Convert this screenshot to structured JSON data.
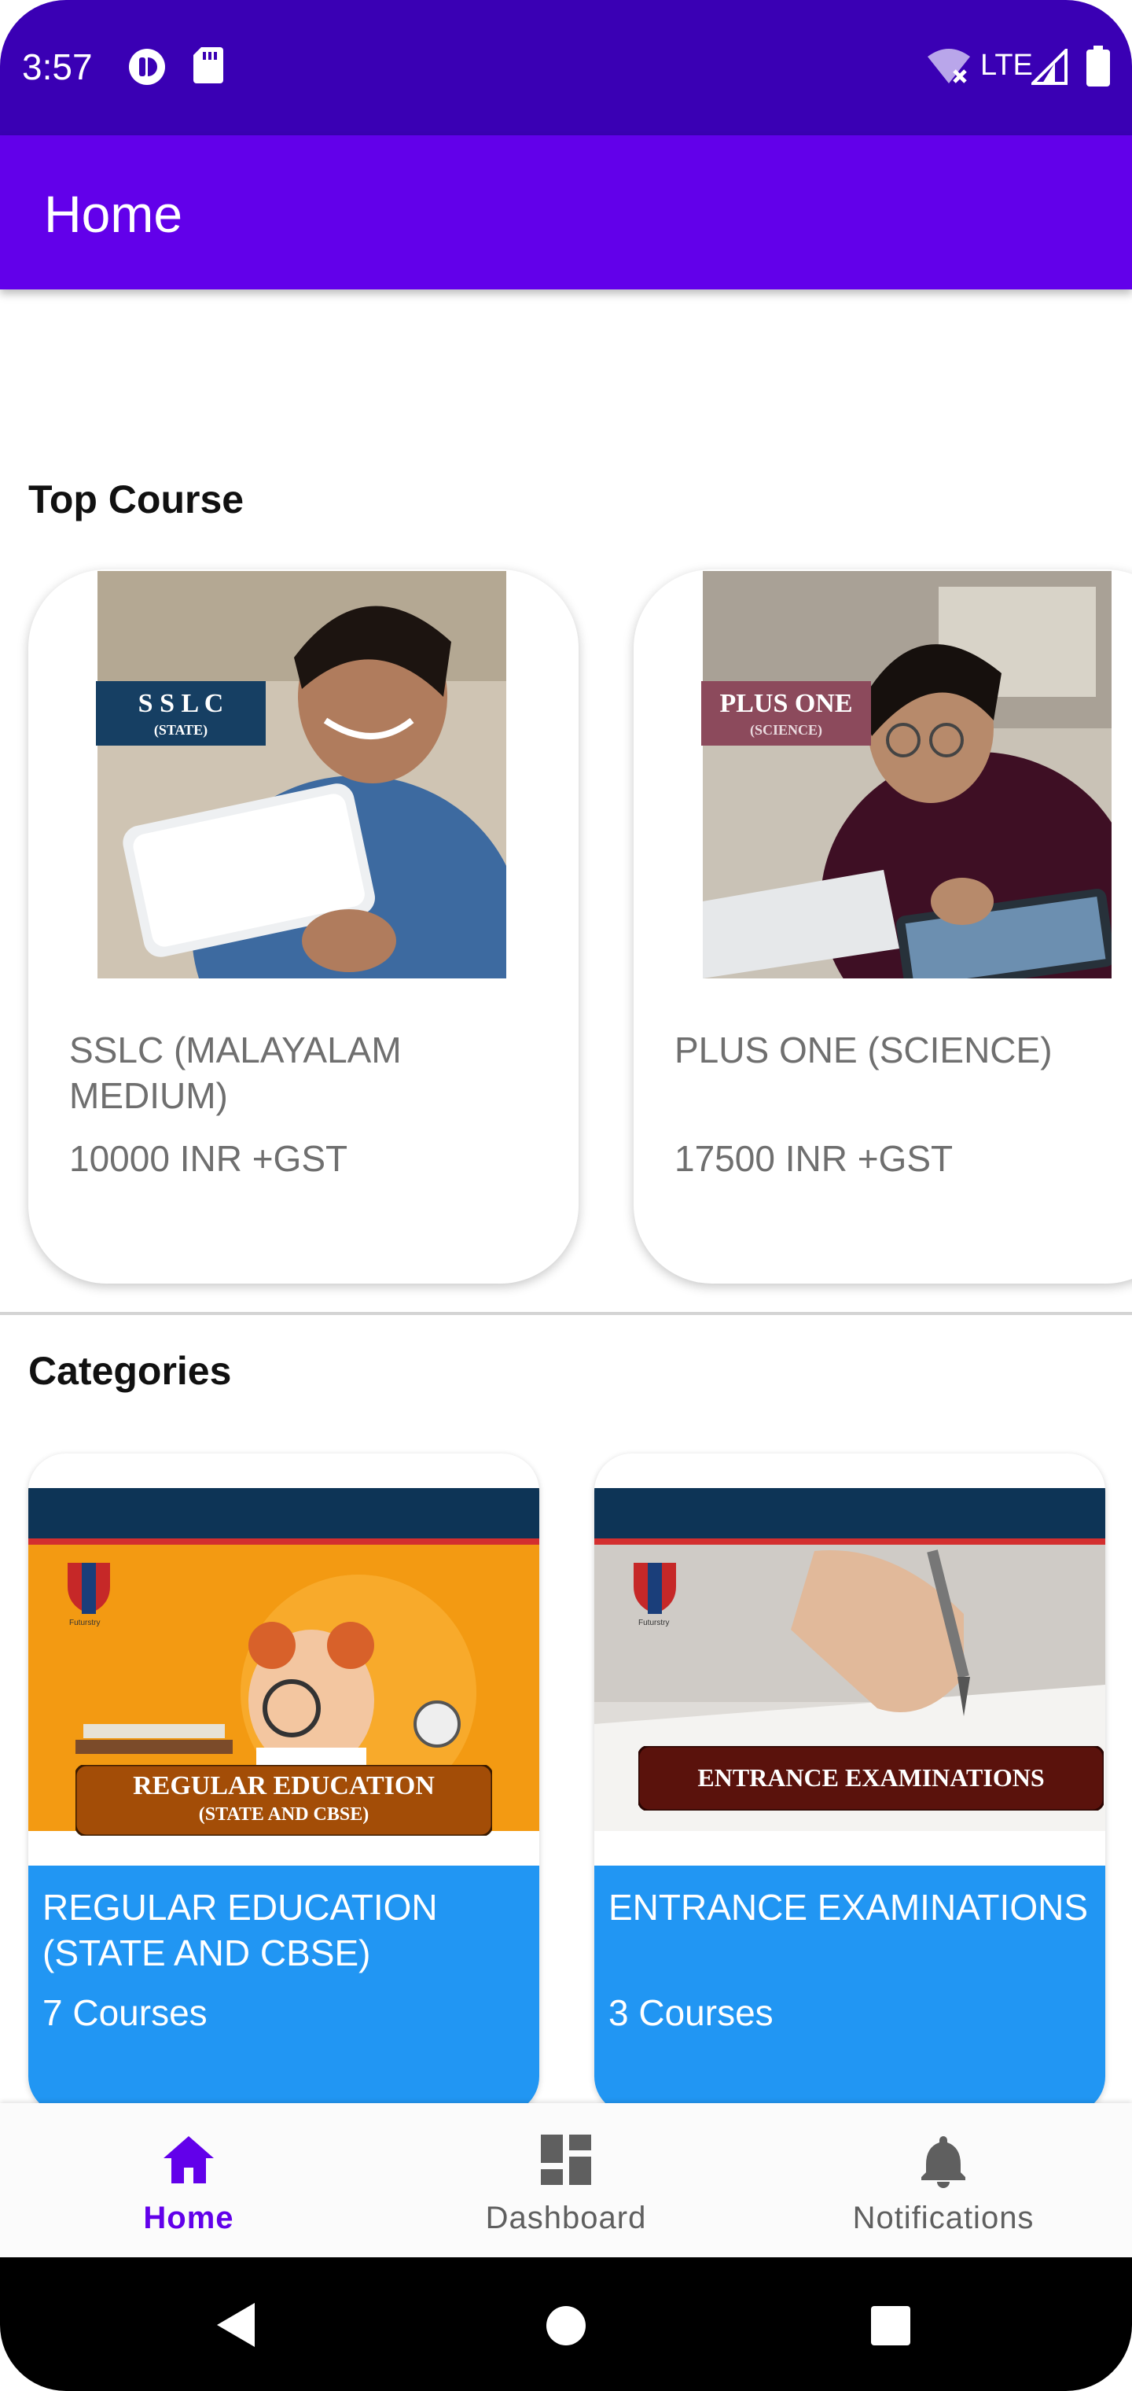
{
  "status_bar": {
    "time": "3:57",
    "network": "LTE"
  },
  "app_bar": {
    "title": "Home"
  },
  "sections": {
    "top_course": "Top Course",
    "categories": "Categories"
  },
  "top_courses": [
    {
      "name": "SSLC (MALAYALAM MEDIUM)",
      "price": "10000 INR +GST",
      "badge_title": "S S L C",
      "badge_sub": "(STATE)",
      "badge_color": "#163f63"
    },
    {
      "name": "PLUS ONE (SCIENCE)",
      "price": "17500 INR +GST",
      "badge_title": "PLUS ONE",
      "badge_sub": "(SCIENCE)",
      "badge_color": "#8c4a5c"
    }
  ],
  "categories": [
    {
      "name": "REGULAR EDUCATION (STATE AND CBSE)",
      "count": "7 Courses",
      "banner_title": "REGULAR EDUCATION",
      "banner_sub": "(STATE AND CBSE)",
      "logo_text": "Futurstry"
    },
    {
      "name": "ENTRANCE EXAMINATIONS",
      "count": "3 Courses",
      "banner_title": "ENTRANCE EXAMINATIONS",
      "logo_text": "Futurstry"
    }
  ],
  "bottom_nav": [
    {
      "label": "Home",
      "icon": "home-icon",
      "active": true
    },
    {
      "label": "Dashboard",
      "icon": "dashboard-icon",
      "active": false
    },
    {
      "label": "Notifications",
      "icon": "bell-icon",
      "active": false
    }
  ],
  "colors": {
    "status_bar": "#3a00b4",
    "app_bar": "#6200ea",
    "category_info": "#2196f3",
    "nav_active": "#6200ea",
    "nav_inactive": "#5f5f5f"
  }
}
